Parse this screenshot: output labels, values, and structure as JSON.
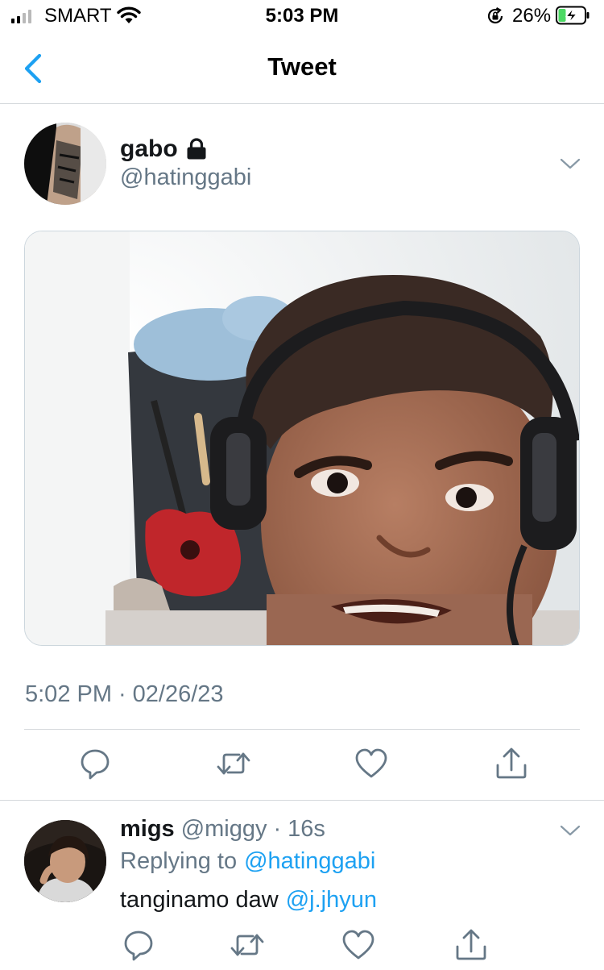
{
  "status_bar": {
    "carrier": "SMART",
    "time": "5:03 PM",
    "battery_percent": "26%",
    "signal_bars_filled": 2,
    "signal_bars_total": 4,
    "charging": true
  },
  "nav": {
    "title": "Tweet",
    "back_icon": "chevron-left-icon"
  },
  "tweet": {
    "display_name": "gabo",
    "protected_icon": "lock-icon",
    "handle": "@hatinggabi",
    "timestamp_time": "5:02 PM",
    "timestamp_separator": "·",
    "timestamp_date": "02/26/23",
    "actions": [
      "reply-icon",
      "retweet-icon",
      "like-icon",
      "share-icon"
    ]
  },
  "reply": {
    "display_name": "migs",
    "handle": "@miggy",
    "separator": "·",
    "time": "16s",
    "replying_prefix": "Replying to",
    "replying_handle": "@hatinggabi",
    "text": "tanginamo daw",
    "mention": "@j.jhyun",
    "actions": [
      "reply-icon",
      "retweet-icon",
      "like-icon",
      "share-icon"
    ]
  },
  "colors": {
    "accent": "#1da1f2",
    "secondary_text": "#657786",
    "border": "#d5d9dc",
    "battery_charging": "#4cd964"
  }
}
